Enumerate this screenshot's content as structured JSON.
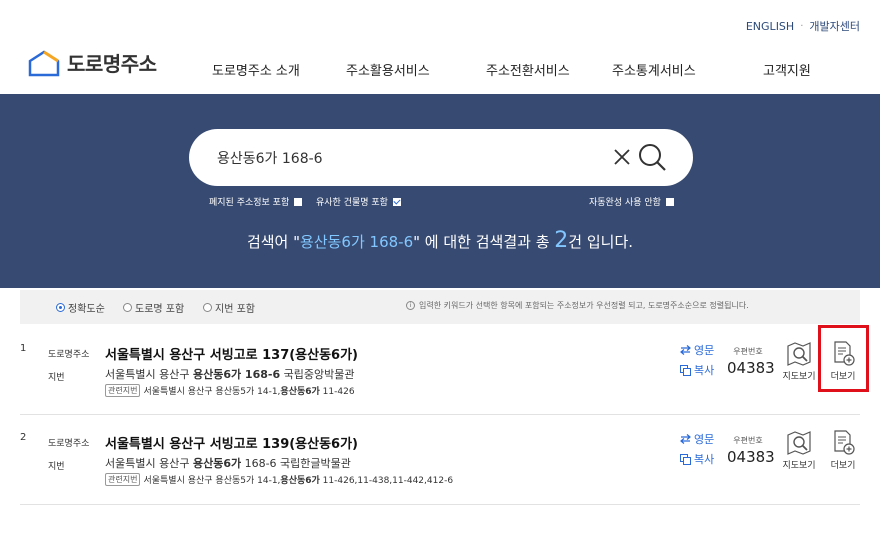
{
  "top_links": {
    "english": "ENGLISH",
    "dev_center": "개발자센터"
  },
  "logo": {
    "text": "도로명주소"
  },
  "nav": [
    "도로명주소 소개",
    "주소활용서비스",
    "주소전환서비스",
    "주소통계서비스",
    "고객지원"
  ],
  "search": {
    "value": "용산동6가 168-6",
    "options": {
      "abolished": "폐지된 주소정보 포함",
      "similar_building": "유사한 건물명 포함",
      "autocomplete_off": "자동완성 사용 안함"
    }
  },
  "summary": {
    "prefix": "검색어 \"",
    "keyword": "용산동6가 168-6",
    "middle": "\" 에 대한 검색결과 총 ",
    "count": "2",
    "suffix": "건 입니다."
  },
  "filters": {
    "exact": "정확도순",
    "road": "도로명 포함",
    "jibun": "지번 포함",
    "notice": "입력한 키워드가 선택한 항목에 포함되는 주소정보가 우선정렬 되고, 도로명주소순으로 정렬됩니다."
  },
  "labels": {
    "road": "도로명주소",
    "jibun": "지번",
    "related": "관련지번",
    "english": "영문",
    "copy": "복사",
    "postal": "우편번호",
    "map": "지도보기",
    "more": "더보기"
  },
  "results": [
    {
      "num": "1",
      "road_addr": "서울특별시 용산구 서빙고로 137(용산동6가)",
      "jibun_prefix": "서울특별시 용산구 ",
      "jibun_bold": "용산동6가 168-6",
      "jibun_suffix": " 국립중앙박물관",
      "related_prefix": "서울특별시 용산구 용산동5가 14-1,",
      "related_bold": "용산동6가",
      "related_suffix": " 11-426",
      "postal": "04383"
    },
    {
      "num": "2",
      "road_addr": "서울특별시 용산구 서빙고로 139(용산동6가)",
      "jibun_prefix": "서울특별시 용산구 ",
      "jibun_bold": "용산동6가",
      "jibun_suffix": " 168-6 국립한글박물관",
      "related_prefix": "서울특별시 용산구 용산동5가 14-1,",
      "related_bold": "용산동6가",
      "related_suffix": " 11-426,11-438,11-442,412-6",
      "postal": "04383"
    }
  ],
  "colors": {
    "hero": "#374a71",
    "accent": "#2a6ad8",
    "highlight": "#e0101a"
  }
}
